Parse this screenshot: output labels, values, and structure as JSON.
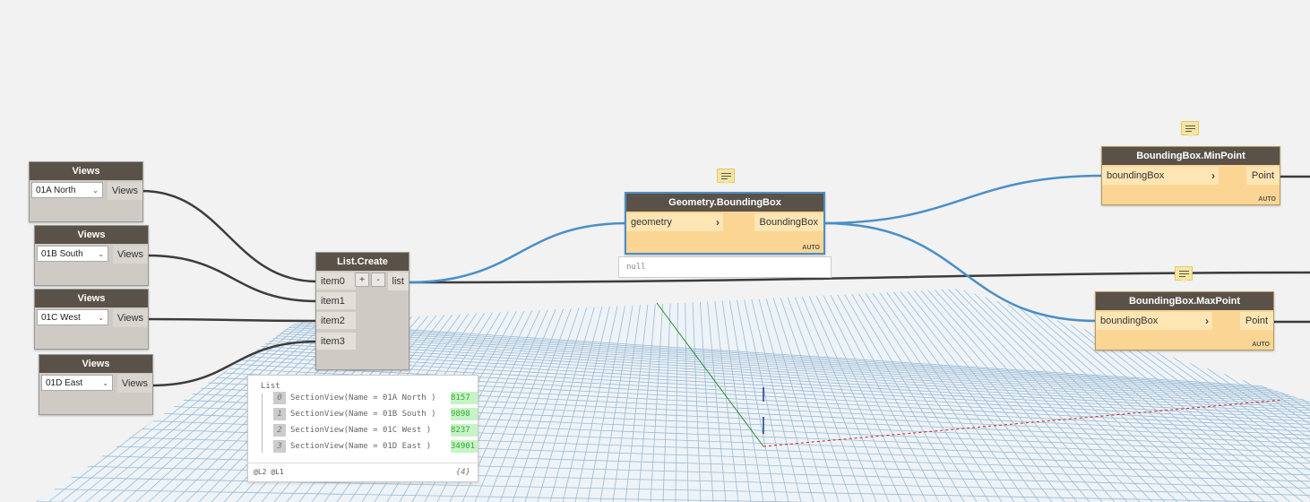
{
  "colors": {
    "wire_selected": "#4a8fc7",
    "wire_default": "#3c3c3c",
    "node_header": "#5a5248",
    "orange_node": "#fbd593",
    "grid": "#9bbbd4"
  },
  "views_nodes": [
    {
      "title": "Views",
      "selected": "01A North",
      "output": "Views"
    },
    {
      "title": "Views",
      "selected": "01B South",
      "output": "Views"
    },
    {
      "title": "Views",
      "selected": "01C West",
      "output": "Views"
    },
    {
      "title": "Views",
      "selected": "01D East",
      "output": "Views"
    }
  ],
  "list_create": {
    "title": "List.Create",
    "inputs": [
      "item0",
      "item1",
      "item2",
      "item3"
    ],
    "plus": "+",
    "minus": "-",
    "output": "list"
  },
  "bbox_node": {
    "title": "Geometry.BoundingBox",
    "input": "geometry",
    "output": "BoundingBox",
    "lacing": "AUTO",
    "preview": "null"
  },
  "minpoint_node": {
    "title": "BoundingBox.MinPoint",
    "input": "boundingBox",
    "output": "Point",
    "lacing": "AUTO"
  },
  "maxpoint_node": {
    "title": "BoundingBox.MaxPoint",
    "input": "boundingBox",
    "output": "Point",
    "lacing": "AUTO"
  },
  "watch": {
    "header": "List",
    "rows": [
      {
        "index": "0",
        "text": "SectionView(Name = 01A North )",
        "id": "8157"
      },
      {
        "index": "1",
        "text": "SectionView(Name = 01B South )",
        "id": "9898"
      },
      {
        "index": "2",
        "text": "SectionView(Name = 01C West )",
        "id": "8237"
      },
      {
        "index": "3",
        "text": "SectionView(Name = 01D East )",
        "id": "34901"
      }
    ],
    "levels": "@L2 @L1",
    "count": "{4}"
  }
}
